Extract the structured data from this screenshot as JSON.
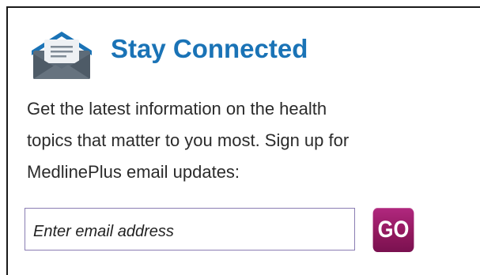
{
  "widget": {
    "title": "Stay Connected",
    "icon": "envelope-icon",
    "description": "Get the latest information on the health\ntopics that matter to you most. Sign up for\nMedlinePlus email updates:"
  },
  "form": {
    "email_placeholder": "Enter email address",
    "email_value": "",
    "go_label": "GO"
  },
  "colors": {
    "title": "#1a73b6",
    "go_button": "#93195f",
    "input_border": "#8a7db3",
    "icon_envelope": "#5d6b78",
    "icon_roof": "#1a73b6"
  }
}
